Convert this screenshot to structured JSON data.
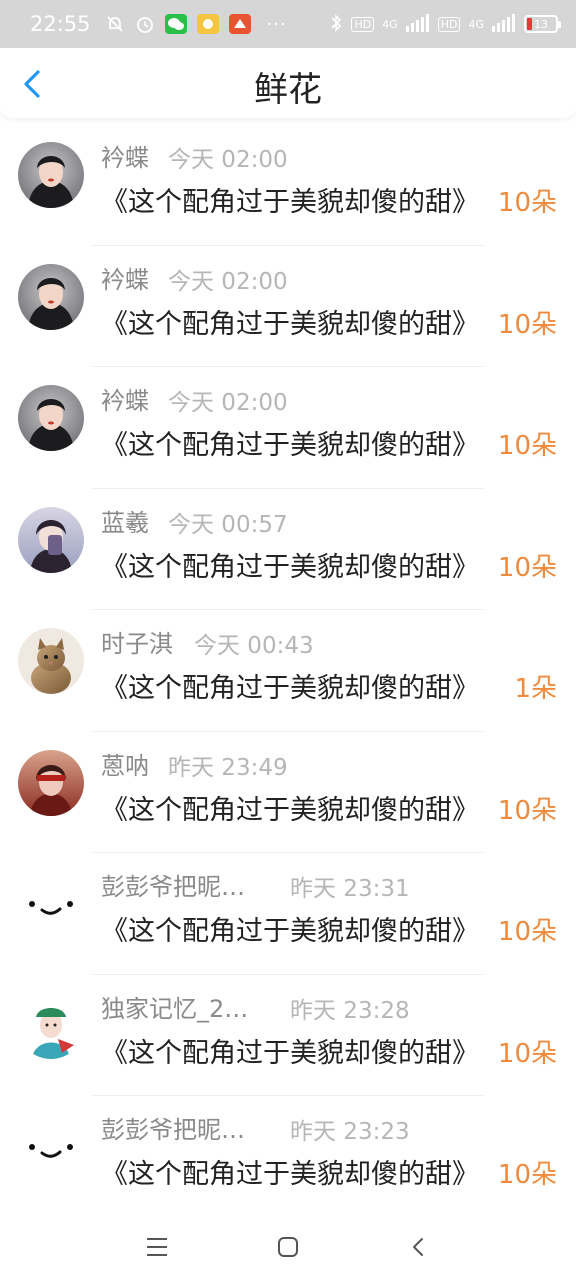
{
  "status_bar": {
    "time": "22:55",
    "network_left": "HD",
    "network_label": "4G",
    "network_right": "HD",
    "network_label2": "4G",
    "battery": "13",
    "more": "···"
  },
  "header": {
    "title": "鲜花",
    "back_icon": "chevron-left-icon"
  },
  "list": [
    {
      "name": "衿蝶",
      "time": "今天 02:00",
      "message": "《这个配角过于美貌却傻的甜》",
      "count": "10朵",
      "avatar": "photo-woman-1"
    },
    {
      "name": "衿蝶",
      "time": "今天 02:00",
      "message": "《这个配角过于美貌却傻的甜》",
      "count": "10朵",
      "avatar": "photo-woman-1"
    },
    {
      "name": "衿蝶",
      "time": "今天 02:00",
      "message": "《这个配角过于美貌却傻的甜》",
      "count": "10朵",
      "avatar": "photo-woman-1"
    },
    {
      "name": "蓝羲",
      "time": "今天 00:57",
      "message": "《这个配角过于美貌却傻的甜》",
      "count": "10朵",
      "avatar": "photo-woman-2"
    },
    {
      "name": "时子淇",
      "time": "今天 00:43",
      "message": "《这个配角过于美貌却傻的甜》",
      "count": "1朵",
      "avatar": "photo-kitten"
    },
    {
      "name": "蒽呐",
      "time": "昨天 23:49",
      "message": "《这个配角过于美貌却傻的甜》",
      "count": "10朵",
      "avatar": "photo-woman-3"
    },
    {
      "name": "彭彭爷把昵…",
      "time": "昨天 23:31",
      "message": "《这个配角过于美貌却傻的甜》",
      "count": "10朵",
      "avatar": "smiley-face"
    },
    {
      "name": "独家记忆_2…",
      "time": "昨天 23:28",
      "message": "《这个配角过于美貌却傻的甜》",
      "count": "10朵",
      "avatar": "cartoon-girl"
    },
    {
      "name": "彭彭爷把昵…",
      "time": "昨天 23:23",
      "message": "《这个配角过于美貌却傻的甜》",
      "count": "10朵",
      "avatar": "smiley-face"
    }
  ],
  "nav": {
    "menu_icon": "menu-icon",
    "home_icon": "home-icon",
    "back_icon": "back-icon"
  },
  "colors": {
    "accent": "#2196F3",
    "count": "#f08a3c",
    "statusbar": "#d6d6d6"
  }
}
